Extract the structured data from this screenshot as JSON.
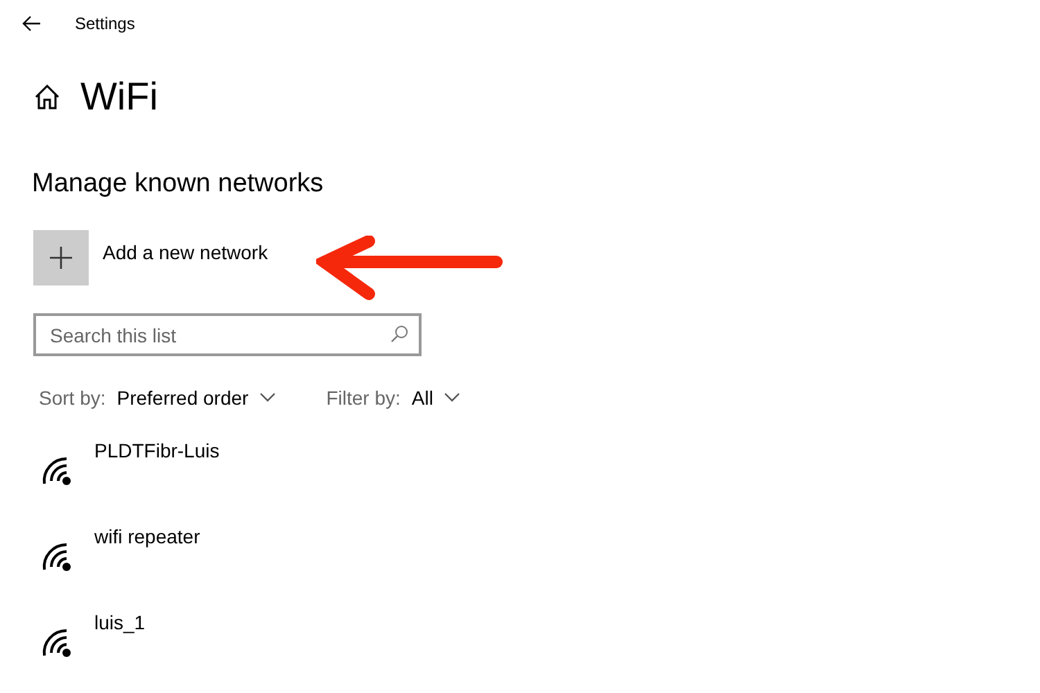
{
  "header": {
    "title": "Settings"
  },
  "page": {
    "title": "WiFi"
  },
  "section": {
    "title": "Manage known networks"
  },
  "add_button": {
    "label": "Add a new network"
  },
  "search": {
    "placeholder": "Search this list"
  },
  "sort": {
    "label": "Sort by:",
    "value": "Preferred order"
  },
  "filter": {
    "label": "Filter by:",
    "value": "All"
  },
  "networks": [
    {
      "name": "PLDTFibr-Luis"
    },
    {
      "name": "wifi repeater"
    },
    {
      "name": "luis_1"
    }
  ]
}
